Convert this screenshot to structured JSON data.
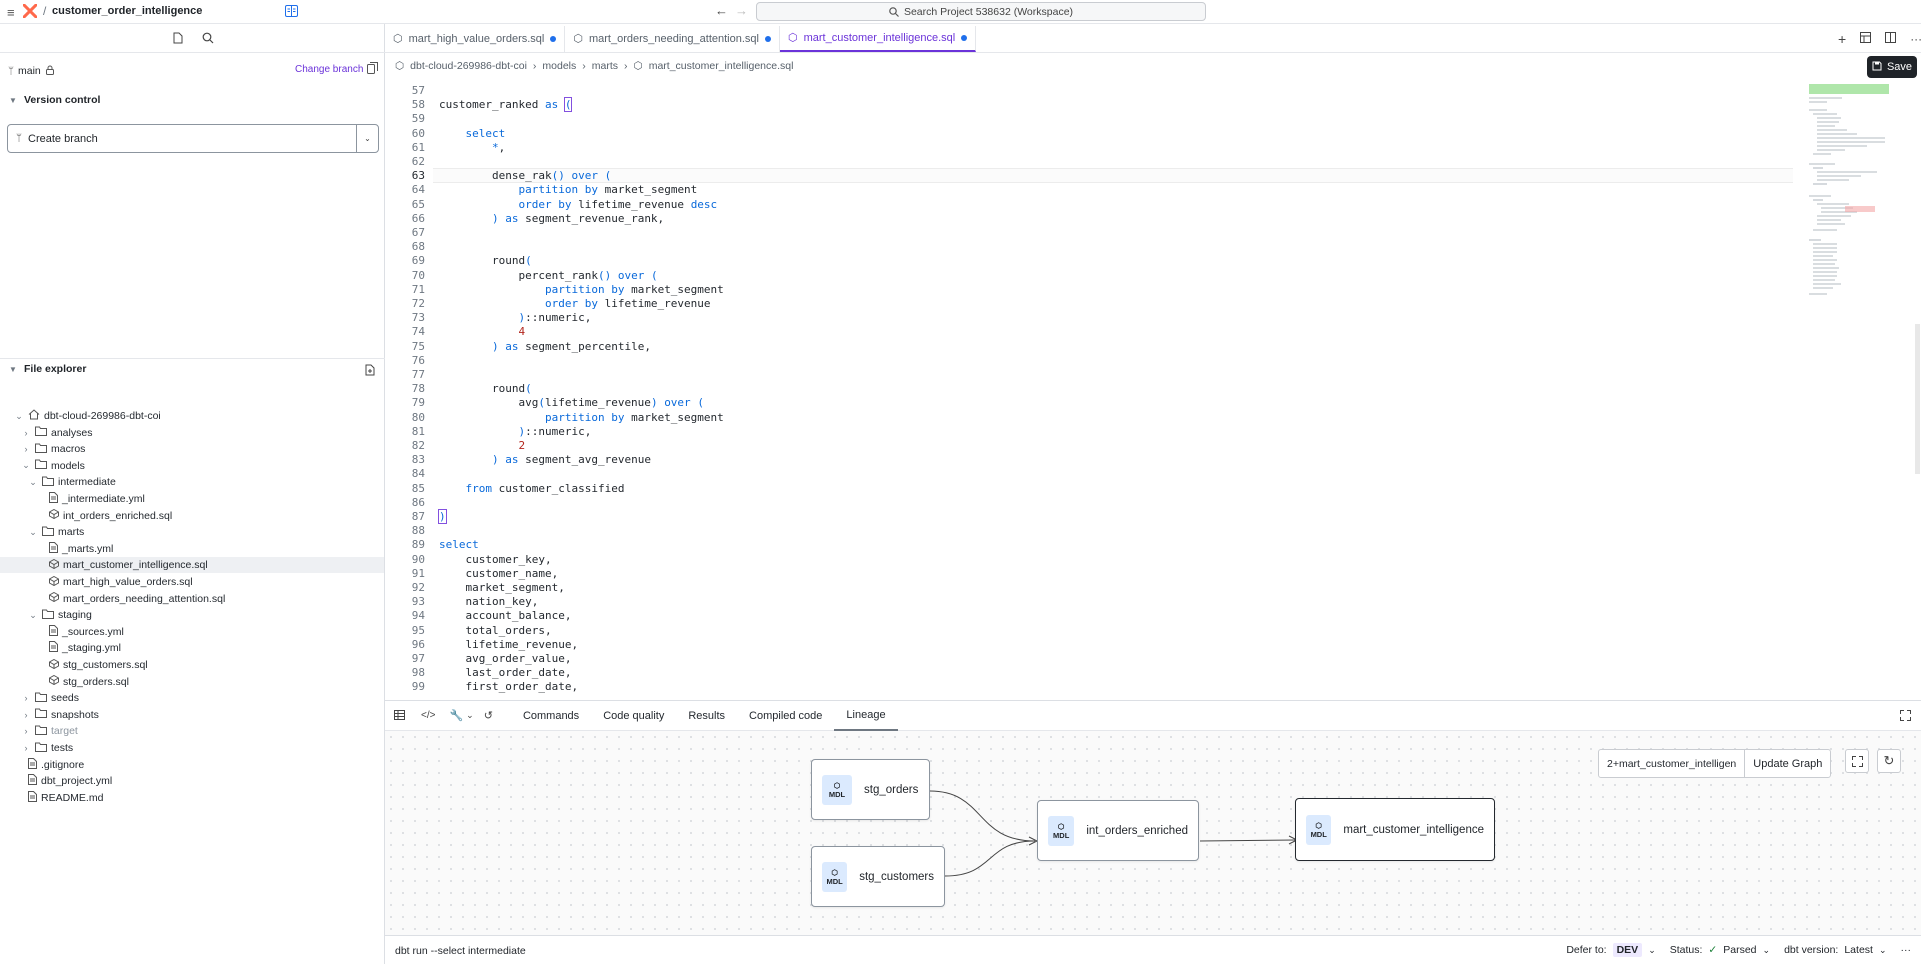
{
  "top": {
    "project": "customer_order_intelligence",
    "search_placeholder": "Search Project 538632 (Workspace)"
  },
  "left": {
    "branch": "main",
    "change_branch": "Change branch",
    "version_control": "Version control",
    "create_branch": "Create branch",
    "file_explorer": "File explorer",
    "tree": [
      {
        "label": "dbt-cloud-269986-dbt-coi",
        "depth": 0,
        "kind": "home",
        "chev": "open"
      },
      {
        "label": "analyses",
        "depth": 1,
        "kind": "folder",
        "chev": "closed"
      },
      {
        "label": "macros",
        "depth": 1,
        "kind": "folder",
        "chev": "closed"
      },
      {
        "label": "models",
        "depth": 1,
        "kind": "folder",
        "chev": "open"
      },
      {
        "label": "intermediate",
        "depth": 2,
        "kind": "folder",
        "chev": "open"
      },
      {
        "label": "_intermediate.yml",
        "depth": 3,
        "kind": "file"
      },
      {
        "label": "int_orders_enriched.sql",
        "depth": 3,
        "kind": "model"
      },
      {
        "label": "marts",
        "depth": 2,
        "kind": "folder",
        "chev": "open"
      },
      {
        "label": "_marts.yml",
        "depth": 3,
        "kind": "file"
      },
      {
        "label": "mart_customer_intelligence.sql",
        "depth": 3,
        "kind": "model",
        "selected": true
      },
      {
        "label": "mart_high_value_orders.sql",
        "depth": 3,
        "kind": "model"
      },
      {
        "label": "mart_orders_needing_attention.sql",
        "depth": 3,
        "kind": "model"
      },
      {
        "label": "staging",
        "depth": 2,
        "kind": "folder",
        "chev": "open"
      },
      {
        "label": "_sources.yml",
        "depth": 3,
        "kind": "file"
      },
      {
        "label": "_staging.yml",
        "depth": 3,
        "kind": "file"
      },
      {
        "label": "stg_customers.sql",
        "depth": 3,
        "kind": "model"
      },
      {
        "label": "stg_orders.sql",
        "depth": 3,
        "kind": "model"
      },
      {
        "label": "seeds",
        "depth": 1,
        "kind": "folder",
        "chev": "closed"
      },
      {
        "label": "snapshots",
        "depth": 1,
        "kind": "folder",
        "chev": "closed"
      },
      {
        "label": "target",
        "depth": 1,
        "kind": "folder",
        "chev": "closed",
        "muted": true
      },
      {
        "label": "tests",
        "depth": 1,
        "kind": "folder",
        "chev": "closed"
      },
      {
        "label": ".gitignore",
        "depth": 0,
        "kind": "file"
      },
      {
        "label": "dbt_project.yml",
        "depth": 0,
        "kind": "file"
      },
      {
        "label": "README.md",
        "depth": 0,
        "kind": "file"
      }
    ]
  },
  "tabs": [
    {
      "label": "mart_high_value_orders.sql",
      "active": false
    },
    {
      "label": "mart_orders_needing_attention.sql",
      "active": false
    },
    {
      "label": "mart_customer_intelligence.sql",
      "active": true
    }
  ],
  "breadcrumb": [
    "dbt-cloud-269986-dbt-coi",
    "models",
    "marts",
    "mart_customer_intelligence.sql"
  ],
  "save": "Save",
  "code": [
    {
      "n": "57",
      "t": ""
    },
    {
      "n": "58",
      "t": "customer_ranked <k>as</k> <b>(</b>"
    },
    {
      "n": "59",
      "t": ""
    },
    {
      "n": "60",
      "t": "    <k>select</k>"
    },
    {
      "n": "61",
      "t": "        <k>*</k>,"
    },
    {
      "n": "62",
      "t": ""
    },
    {
      "n": "63",
      "t": "        dense_rak<k>()</k> <k>over</k> <k>(</k>"
    },
    {
      "n": "64",
      "t": "            <k>partition by</k> market_segment"
    },
    {
      "n": "65",
      "t": "            <k>order by</k> lifetime_revenue <k>desc</k>"
    },
    {
      "n": "66",
      "t": "        <k>)</k> <k>as</k> segment_revenue_rank,"
    },
    {
      "n": "67",
      "t": ""
    },
    {
      "n": "68",
      "t": ""
    },
    {
      "n": "69",
      "t": "        round<k>(</k>"
    },
    {
      "n": "70",
      "t": "            percent_rank<k>()</k> <k>over</k> <k>(</k>"
    },
    {
      "n": "71",
      "t": "                <k>partition by</k> market_segment"
    },
    {
      "n": "72",
      "t": "                <k>order by</k> lifetime_revenue"
    },
    {
      "n": "73",
      "t": "            <k>)</k>::numeric,"
    },
    {
      "n": "74",
      "t": "            <n>4</n>"
    },
    {
      "n": "75",
      "t": "        <k>)</k> <k>as</k> segment_percentile,"
    },
    {
      "n": "76",
      "t": ""
    },
    {
      "n": "77",
      "t": ""
    },
    {
      "n": "78",
      "t": "        round<k>(</k>"
    },
    {
      "n": "79",
      "t": "            avg<k>(</k>lifetime_revenue<k>)</k> <k>over</k> <k>(</k>"
    },
    {
      "n": "80",
      "t": "                <k>partition by</k> market_segment"
    },
    {
      "n": "81",
      "t": "            <k>)</k>::numeric,"
    },
    {
      "n": "82",
      "t": "            <n>2</n>"
    },
    {
      "n": "83",
      "t": "        <k>)</k> <k>as</k> segment_avg_revenue"
    },
    {
      "n": "84",
      "t": ""
    },
    {
      "n": "85",
      "t": "    <k>from</k> customer_classified"
    },
    {
      "n": "86",
      "t": ""
    },
    {
      "n": "87",
      "t": "<b>)</b>"
    },
    {
      "n": "88",
      "t": ""
    },
    {
      "n": "89",
      "t": "<k>select</k>"
    },
    {
      "n": "90",
      "t": "    customer_key,"
    },
    {
      "n": "91",
      "t": "    customer_name,"
    },
    {
      "n": "92",
      "t": "    market_segment,"
    },
    {
      "n": "93",
      "t": "    nation_key,"
    },
    {
      "n": "94",
      "t": "    account_balance,"
    },
    {
      "n": "95",
      "t": "    total_orders,"
    },
    {
      "n": "96",
      "t": "    lifetime_revenue,"
    },
    {
      "n": "97",
      "t": "    avg_order_value,"
    },
    {
      "n": "98",
      "t": "    last_order_date,"
    },
    {
      "n": "99",
      "t": "    first_order_date,"
    }
  ],
  "bottom_tabs": [
    "Commands",
    "Code quality",
    "Results",
    "Compiled code",
    "Lineage"
  ],
  "lineage": {
    "select_value": "2+mart_customer_intelligen",
    "update_graph": "Update Graph",
    "badge": "MDL",
    "nodes": [
      "stg_orders",
      "stg_customers",
      "int_orders_enriched",
      "mart_customer_intelligence"
    ]
  },
  "status": {
    "command": "dbt run --select intermediate",
    "defer_label": "Defer to:",
    "defer_value": "DEV",
    "status_label": "Status:",
    "status_value": "Parsed",
    "version_label": "dbt version:",
    "version_value": "Latest"
  }
}
